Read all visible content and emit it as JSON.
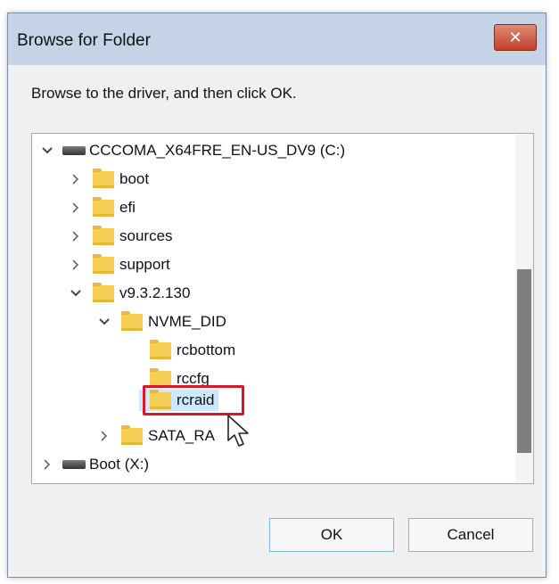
{
  "window": {
    "title": "Browse for Folder",
    "close_glyph": "✕"
  },
  "instruction": "Browse to the driver, and then click OK.",
  "tree": [
    {
      "label": "CCCOMA_X64FRE_EN-US_DV9 (C:)",
      "icon": "drive-icon",
      "expanded": true
    },
    {
      "label": "boot",
      "icon": "folder-icon",
      "expanded": false
    },
    {
      "label": "efi",
      "icon": "folder-icon",
      "expanded": false
    },
    {
      "label": "sources",
      "icon": "folder-icon",
      "expanded": false
    },
    {
      "label": "support",
      "icon": "folder-icon",
      "expanded": false
    },
    {
      "label": "v9.3.2.130",
      "icon": "folder-icon",
      "expanded": true
    },
    {
      "label": "NVME_DID",
      "icon": "folder-icon",
      "expanded": true
    },
    {
      "label": "rcbottom",
      "icon": "folder-icon"
    },
    {
      "label": "rccfg",
      "icon": "folder-icon"
    },
    {
      "label": "rcraid",
      "icon": "folder-icon",
      "selected": true
    },
    {
      "label": "SATA_RA",
      "icon": "folder-icon",
      "expanded": false
    },
    {
      "label": "Boot (X:)",
      "icon": "drive-icon",
      "expanded": false
    }
  ],
  "buttons": {
    "ok": "OK",
    "cancel": "Cancel"
  },
  "colors": {
    "selection_outline": "#d6192a",
    "selection_fill": "#cce8ff",
    "folder": "#f5cf55"
  }
}
